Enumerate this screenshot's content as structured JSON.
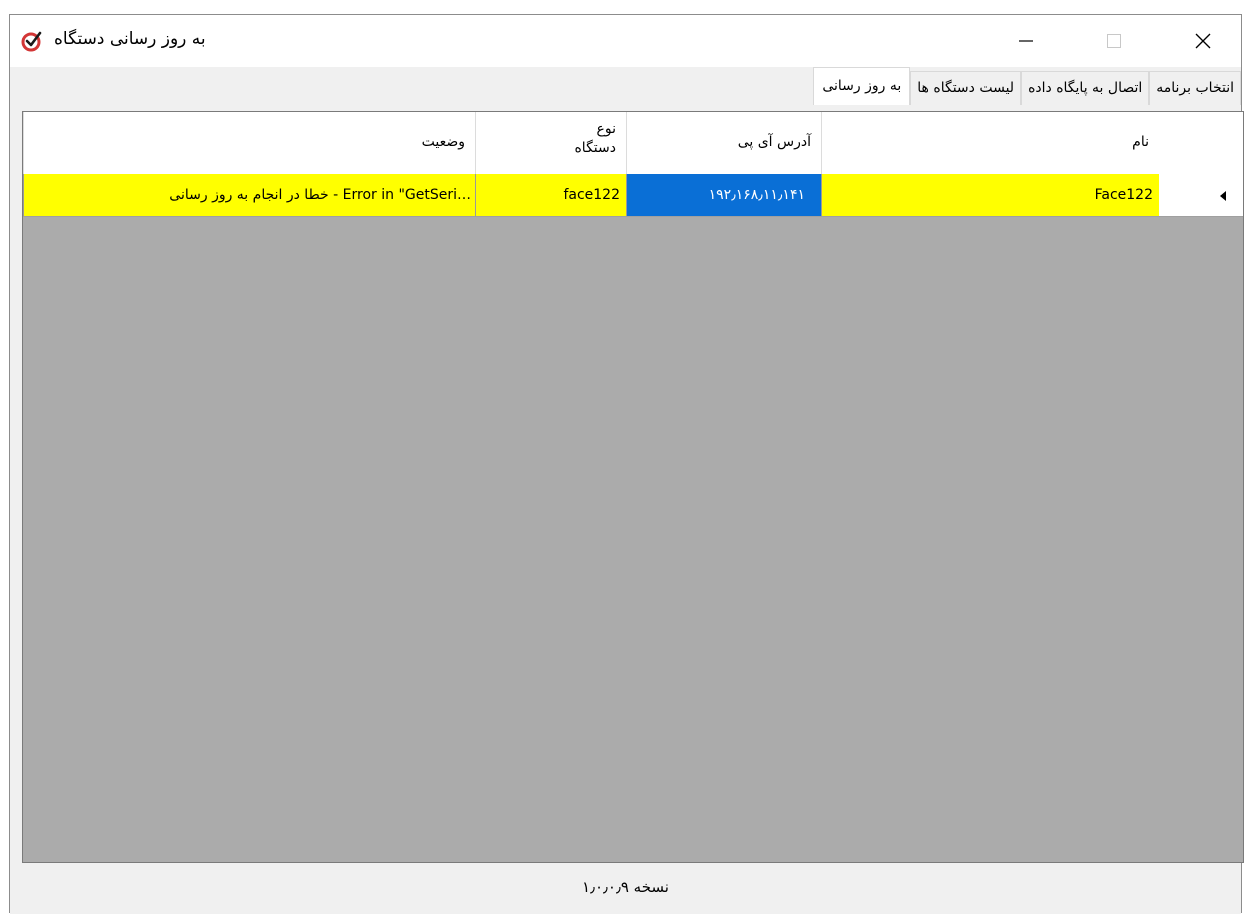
{
  "window": {
    "title": "به روز رسانی دستگاه",
    "icon": "check-circle-icon",
    "accent_color": "#d33636"
  },
  "tabs": [
    {
      "label": "انتخاب برنامه",
      "active": false
    },
    {
      "label": "اتصال به پایگاه داده",
      "active": false
    },
    {
      "label": "لیست دستگاه ها",
      "active": false
    },
    {
      "label": "به روز رسانی",
      "active": true
    }
  ],
  "grid": {
    "columns": {
      "name": "نام",
      "ip": "آدرس آی پی",
      "type": "نوع\nدستگاه",
      "status": "وضعیت"
    },
    "rows": [
      {
        "name": "Face122",
        "ip": "۱۹۲٫۱۶۸٫۱۱٫۱۴۱",
        "type": "face122",
        "status": "…Error in \"GetSeri - خطا در انجام به روز رسانی"
      }
    ],
    "colors": {
      "highlight": "#ffff00",
      "selection": "#0a6fd6",
      "empty_area": "#ababab"
    }
  },
  "footer": {
    "version": "نسخه ۱٫۰٫۰٫۹"
  }
}
